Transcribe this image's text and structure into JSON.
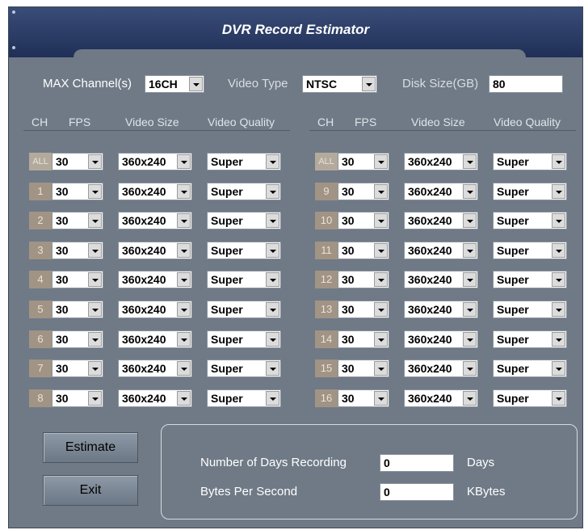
{
  "window": {
    "title": "DVR Record Estimator"
  },
  "settings": {
    "max_channels_label": "MAX Channel(s)",
    "max_channels_value": "16CH",
    "video_type_label": "Video Type",
    "video_type_value": "NTSC",
    "disk_size_label": "Disk Size(GB)",
    "disk_size_value": "80"
  },
  "columns": {
    "ch": "CH",
    "fps": "FPS",
    "size": "Video Size",
    "quality": "Video Quality"
  },
  "left_rows": [
    {
      "ch": "ALL",
      "fps": "30",
      "size": "360x240",
      "quality": "Super"
    },
    {
      "ch": "1",
      "fps": "30",
      "size": "360x240",
      "quality": "Super"
    },
    {
      "ch": "2",
      "fps": "30",
      "size": "360x240",
      "quality": "Super"
    },
    {
      "ch": "3",
      "fps": "30",
      "size": "360x240",
      "quality": "Super"
    },
    {
      "ch": "4",
      "fps": "30",
      "size": "360x240",
      "quality": "Super"
    },
    {
      "ch": "5",
      "fps": "30",
      "size": "360x240",
      "quality": "Super"
    },
    {
      "ch": "6",
      "fps": "30",
      "size": "360x240",
      "quality": "Super"
    },
    {
      "ch": "7",
      "fps": "30",
      "size": "360x240",
      "quality": "Super"
    },
    {
      "ch": "8",
      "fps": "30",
      "size": "360x240",
      "quality": "Super"
    }
  ],
  "right_rows": [
    {
      "ch": "ALL",
      "fps": "30",
      "size": "360x240",
      "quality": "Super"
    },
    {
      "ch": "9",
      "fps": "30",
      "size": "360x240",
      "quality": "Super"
    },
    {
      "ch": "10",
      "fps": "30",
      "size": "360x240",
      "quality": "Super"
    },
    {
      "ch": "11",
      "fps": "30",
      "size": "360x240",
      "quality": "Super"
    },
    {
      "ch": "12",
      "fps": "30",
      "size": "360x240",
      "quality": "Super"
    },
    {
      "ch": "13",
      "fps": "30",
      "size": "360x240",
      "quality": "Super"
    },
    {
      "ch": "14",
      "fps": "30",
      "size": "360x240",
      "quality": "Super"
    },
    {
      "ch": "15",
      "fps": "30",
      "size": "360x240",
      "quality": "Super"
    },
    {
      "ch": "16",
      "fps": "30",
      "size": "360x240",
      "quality": "Super"
    }
  ],
  "actions": {
    "estimate_label": "Estimate",
    "exit_label": "Exit"
  },
  "results": {
    "days_label": "Number of Days Recording",
    "days_value": "0",
    "days_unit": "Days",
    "bps_label": "Bytes Per Second",
    "bps_value": "0",
    "bps_unit": "KBytes"
  }
}
